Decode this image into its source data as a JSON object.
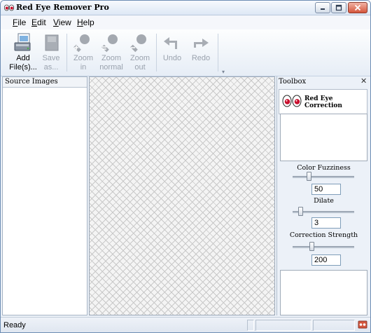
{
  "window": {
    "title": "Red Eye Remover Pro"
  },
  "menu": [
    {
      "label": "File",
      "key": "F",
      "rest": "ile"
    },
    {
      "label": "Edit",
      "key": "E",
      "rest": "dit"
    },
    {
      "label": "View",
      "key": "V",
      "rest": "iew"
    },
    {
      "label": "Help",
      "key": "H",
      "rest": "elp"
    }
  ],
  "toolbar": {
    "add_files": {
      "line1": "Add",
      "line2": "File(s)...",
      "enabled": true,
      "icon": "add-files-icon"
    },
    "save_as": {
      "line1": "Save",
      "line2": "as...",
      "enabled": false,
      "icon": "save-icon"
    },
    "zoom_in": {
      "line1": "Zoom",
      "line2": "in",
      "enabled": false,
      "icon": "zoom-in-icon"
    },
    "zoom_normal": {
      "line1": "Zoom",
      "line2": "normal",
      "enabled": false,
      "icon": "zoom-normal-icon"
    },
    "zoom_out": {
      "line1": "Zoom",
      "line2": "out",
      "enabled": false,
      "icon": "zoom-out-icon"
    },
    "undo": {
      "line1": "Undo",
      "line2": "",
      "enabled": false,
      "icon": "undo-icon"
    },
    "redo": {
      "line1": "Redo",
      "line2": "",
      "enabled": false,
      "icon": "redo-icon"
    },
    "more": "▾"
  },
  "source_panel": {
    "title": "Source Images"
  },
  "toolbox": {
    "title": "Toolbox",
    "close": "✕",
    "tool_name": "Red Eye Correction",
    "params": [
      {
        "label": "Color Fuzziness",
        "value": "50",
        "slider_fraction": 0.25
      },
      {
        "label": "Dilate",
        "value": "3",
        "slider_fraction": 0.1
      },
      {
        "label": "Correction Strength",
        "value": "200",
        "slider_fraction": 0.3
      }
    ]
  },
  "status": {
    "text": "Ready"
  },
  "colors": {
    "accent": "#d4553b",
    "eye_red": "#c8102e",
    "disabled_text": "#9aa2ad"
  }
}
